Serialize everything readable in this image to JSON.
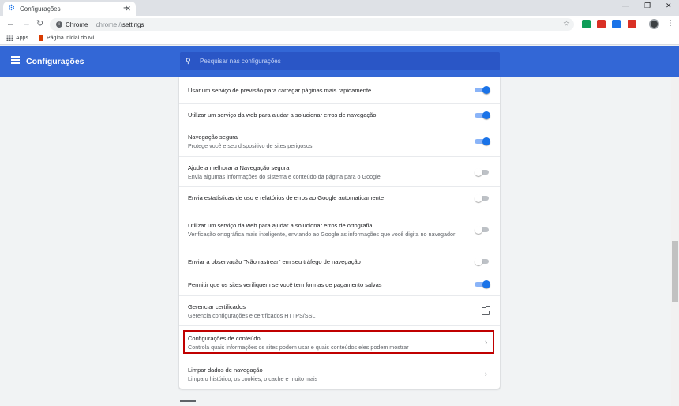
{
  "browser": {
    "tab_title": "Configurações",
    "new_tab_label": "+",
    "omnibox": {
      "site_chip": "Chrome",
      "scheme": "chrome://",
      "path": "settings"
    },
    "bookmarks": [
      {
        "label": "Apps",
        "icon": "apps-grid-icon"
      },
      {
        "label": "Página inicial do Mi...",
        "icon": "office-icon"
      }
    ],
    "extension_colors": [
      "#0f9d58",
      "#d93025",
      "#1a73e8",
      "#d93025"
    ]
  },
  "header": {
    "title": "Configurações",
    "search_placeholder": "Pesquisar nas configurações",
    "bar_color": "#3367d6"
  },
  "settings": {
    "rows": [
      {
        "label": "Usar um serviço de previsão para carregar páginas mais rapidamente",
        "control": "toggle",
        "state": "on"
      },
      {
        "label": "Utilizar um serviço da web para ajudar a solucionar erros de navegação",
        "control": "toggle",
        "state": "on"
      },
      {
        "label": "Navegação segura",
        "sub": "Protege você e seu dispositivo de sites perigosos",
        "control": "toggle",
        "state": "on"
      },
      {
        "label": "Ajude a melhorar a Navegação segura",
        "sub": "Envia algumas informações do sistema e conteúdo da página para o Google",
        "control": "toggle",
        "state": "off"
      },
      {
        "label": "Envia estatísticas de uso e relatórios de erros ao Google automaticamente",
        "control": "toggle",
        "state": "off"
      },
      {
        "label": "Utilizar um serviço da web para ajudar a solucionar erros de ortografia",
        "sub": "Verificação ortográfica mais inteligente, enviando ao Google as informações que você digita no navegador",
        "control": "toggle",
        "state": "off"
      },
      {
        "label": "Enviar a observação \"Não rastrear\" em seu tráfego de navegação",
        "control": "toggle",
        "state": "off"
      },
      {
        "label": "Permitir que os sites verifiquem se você tem formas de pagamento salvas",
        "control": "toggle",
        "state": "on"
      },
      {
        "label": "Gerenciar certificados",
        "sub": "Gerencia configurações e certificados HTTPS/SSL",
        "control": "external-link"
      },
      {
        "label": "Configurações de conteúdo",
        "sub": "Controla quais informações os sites podem usar e quais conteúdos eles podem mostrar",
        "control": "arrow",
        "highlighted": true
      },
      {
        "label": "Limpar dados de navegação",
        "sub": "Limpa o histórico, os cookies, o cache e muito mais",
        "control": "arrow"
      }
    ],
    "toggle_on_color": "#1a73e8",
    "highlight_color": "#c00000"
  }
}
